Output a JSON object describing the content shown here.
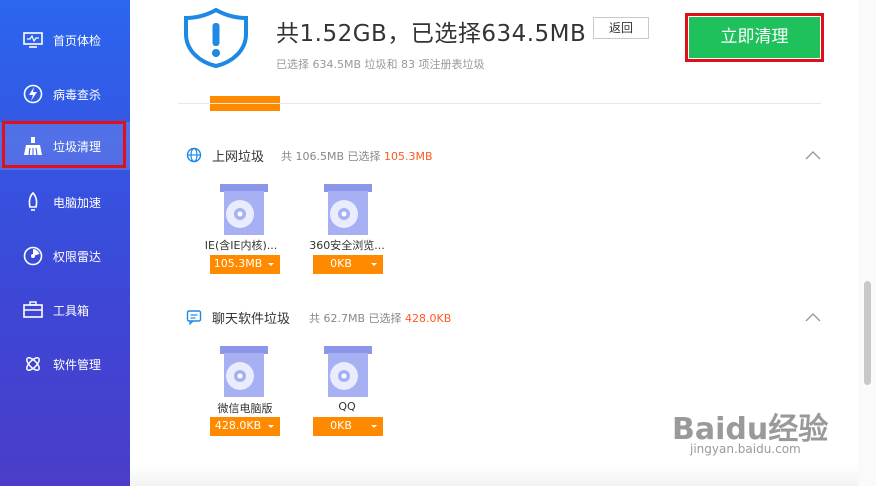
{
  "sidebar": {
    "items": [
      {
        "label": "首页体检",
        "icon": "monitor-icon"
      },
      {
        "label": "病毒查杀",
        "icon": "lightning-icon"
      },
      {
        "label": "垃圾清理",
        "icon": "broom-icon",
        "active": true
      },
      {
        "label": "电脑加速",
        "icon": "rocket-icon"
      },
      {
        "label": "权限雷达",
        "icon": "radar-icon"
      },
      {
        "label": "工具箱",
        "icon": "toolbox-icon"
      },
      {
        "label": "软件管理",
        "icon": "apps-icon"
      }
    ]
  },
  "header": {
    "title": "共1.52GB，已选择634.5MB",
    "back_label": "返回",
    "subtitle": "已选择 634.5MB 垃圾和 83 项注册表垃圾",
    "clean_label": "立即清理"
  },
  "sections": [
    {
      "title": "上网垃圾",
      "total": "共 106.5MB",
      "selected_prefix": "已选择",
      "selected": "105.3MB",
      "items": [
        {
          "name": "IE(含IE内核)...",
          "size": "105.3MB"
        },
        {
          "name": "360安全浏览...",
          "size": "0KB"
        }
      ]
    },
    {
      "title": "聊天软件垃圾",
      "total": "共 62.7MB",
      "selected_prefix": "已选择",
      "selected": "428.0KB",
      "items": [
        {
          "name": "微信电脑版",
          "size": "428.0KB"
        },
        {
          "name": "QQ",
          "size": "0KB"
        }
      ]
    }
  ],
  "watermark": {
    "brand": "Baidu经验",
    "url": "jingyan.baidu.com"
  },
  "colors": {
    "sidebar": "#2b66ef",
    "accent_orange": "#ff8a00",
    "clean_green": "#1ec15c",
    "highlight_red": "#e0101a",
    "selected_text": "#ff5a1f"
  }
}
